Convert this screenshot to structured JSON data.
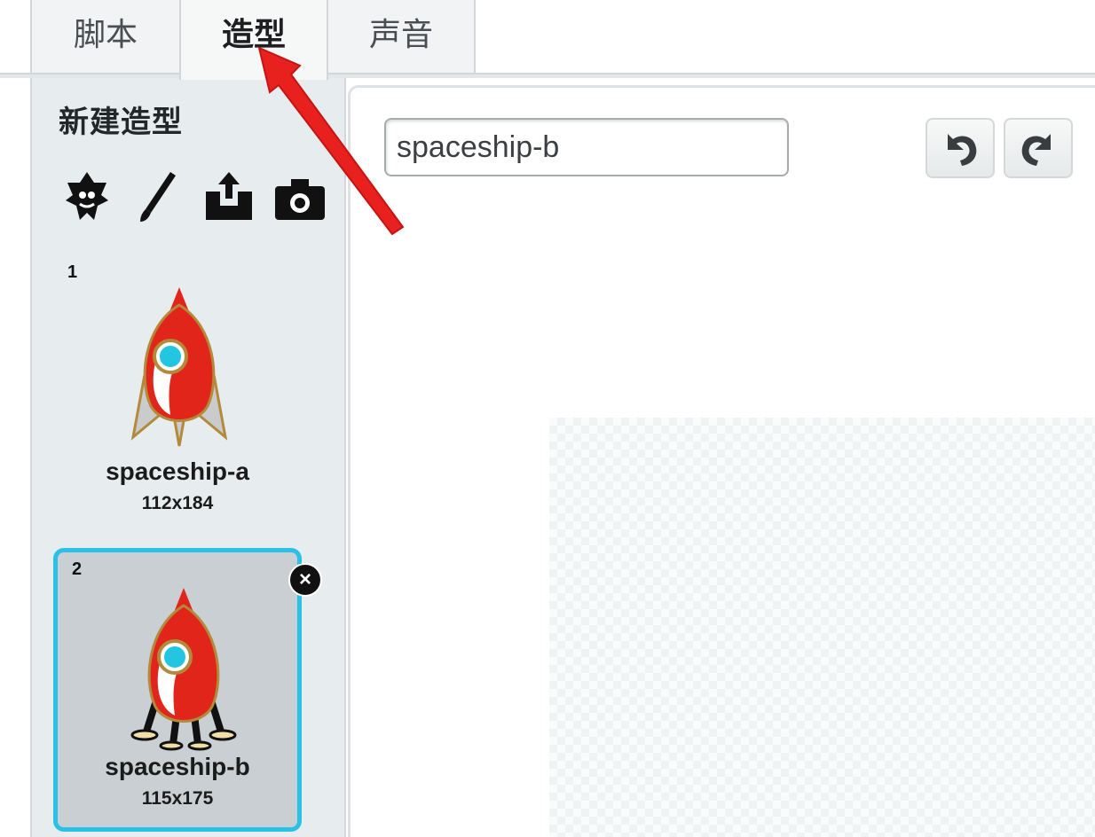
{
  "tabs": [
    {
      "label": "脚本",
      "active": false
    },
    {
      "label": "造型",
      "active": true
    },
    {
      "label": "声音",
      "active": false
    }
  ],
  "sidebar": {
    "title": "新建造型",
    "tools": [
      {
        "icon": "sprite-library-icon"
      },
      {
        "icon": "paint-brush-icon"
      },
      {
        "icon": "upload-icon"
      },
      {
        "icon": "camera-icon"
      }
    ]
  },
  "costumes": [
    {
      "number": "1",
      "name": "spaceship-a",
      "size": "112x184",
      "selected": false,
      "legs": false
    },
    {
      "number": "2",
      "name": "spaceship-b",
      "size": "115x175",
      "selected": true,
      "legs": true
    }
  ],
  "editor": {
    "costume_name_value": "spaceship-b",
    "undo_icon": "undo-icon",
    "redo_icon": "redo-icon"
  },
  "colors": {
    "accent_selected": "#2bc0e6",
    "annotation_arrow": "#e8211f",
    "rocket_red": "#e2251b",
    "rocket_window": "#22c6e0"
  }
}
